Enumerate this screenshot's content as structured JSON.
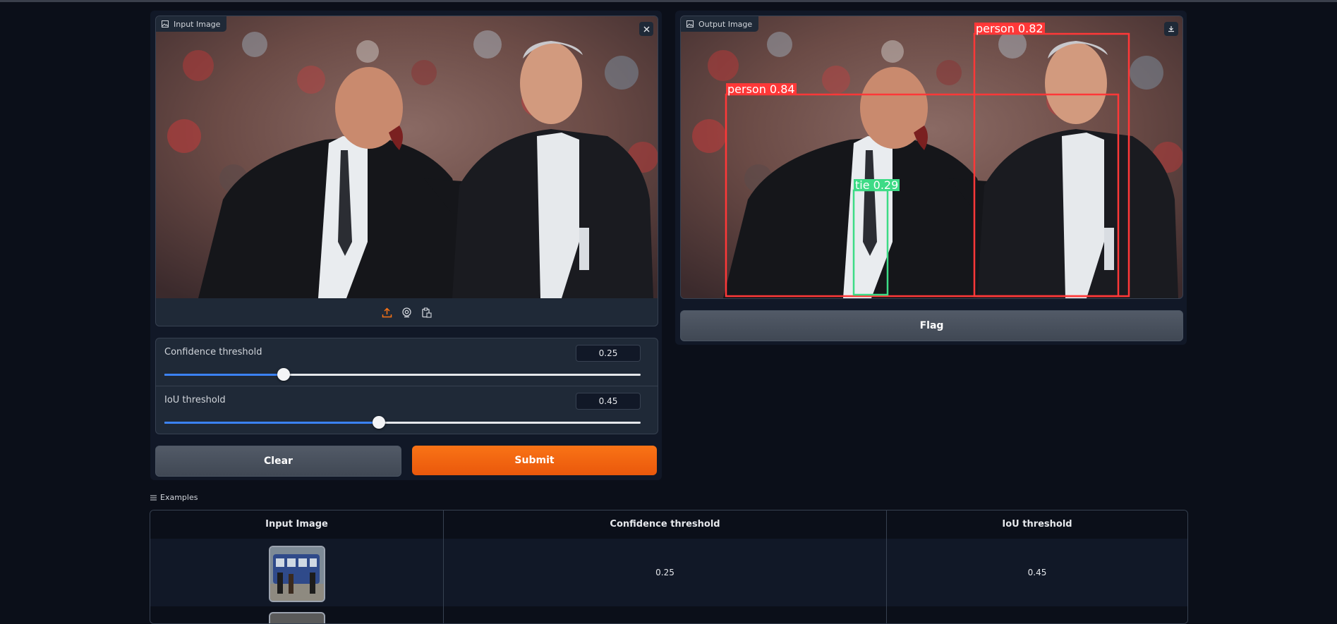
{
  "input_panel": {
    "image_label": "Input Image",
    "toolbar": {
      "icons": [
        "upload-icon",
        "webcam-icon",
        "clipboard-icon"
      ]
    }
  },
  "output_panel": {
    "image_label": "Output Image",
    "detections": [
      {
        "label": "person 0.84",
        "color": "#ff3838"
      },
      {
        "label": "person 0.82",
        "color": "#ff3838"
      },
      {
        "label": "tie 0.29",
        "color": "#3ddb86"
      }
    ],
    "flag_label": "Flag"
  },
  "controls": {
    "confidence": {
      "label": "Confidence threshold",
      "value": "0.25",
      "fraction": 0.25
    },
    "iou": {
      "label": "IoU threshold",
      "value": "0.45",
      "fraction": 0.45
    }
  },
  "actions": {
    "clear_label": "Clear",
    "submit_label": "Submit"
  },
  "examples": {
    "title": "Examples",
    "headers": [
      "Input Image",
      "Confidence threshold",
      "IoU threshold"
    ],
    "rows": [
      {
        "confidence": "0.25",
        "iou": "0.45"
      }
    ]
  },
  "colors": {
    "accent": "#f97316",
    "slider": "#3b82f6",
    "background": "#0b0f19",
    "panel": "#111827"
  }
}
